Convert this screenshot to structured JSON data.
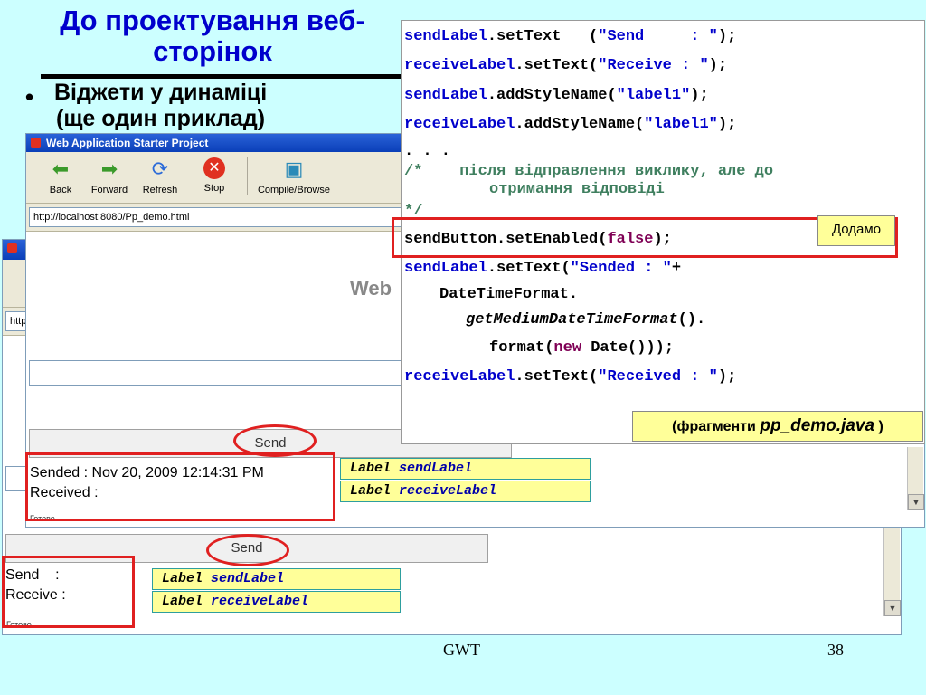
{
  "slide": {
    "title_line1": "До проектування веб-",
    "title_line2": "сторінок",
    "bullet_line1": "Віджети у динаміці",
    "bullet_line2": "(ще один приклад)",
    "footer_center": "GWT",
    "page_number": "38"
  },
  "browser": {
    "window_title": "Web Application Starter Project",
    "toolbar": {
      "back": "Back",
      "forward": "Forward",
      "refresh": "Refresh",
      "stop": "Stop",
      "compile": "Compile/Browse"
    },
    "address": "http://localhost:8080/Pp_demo.html",
    "address_back": "http:",
    "page_heading_partial": "Web",
    "status_text": "Готово"
  },
  "front_window": {
    "send_button": "Send",
    "sent_text": "Sended : Nov 20, 2009 12:14:31 PM",
    "received_text": "Received :"
  },
  "back_window": {
    "send_button": "Send",
    "send_text": "Send    :",
    "receive_text": "Receive :"
  },
  "labels": {
    "type": "Label",
    "send_name": "sendLabel",
    "receive_name": "receiveLabel"
  },
  "code": {
    "l1_var": "sendLabel",
    "l1_a": ".setText   (",
    "l1_str": "\"Send     : \"",
    "l1_b": ");",
    "l2_var": "receiveLabel",
    "l2_a": ".setText(",
    "l2_str": "\"Receive : \"",
    "l2_b": ");",
    "l3_var": "sendLabel",
    "l3_a": ".addStyleName(",
    "l3_str": "\"label1\"",
    "l3_b": ");",
    "l4_var": "receiveLabel",
    "l4_a": ".addStyleName(",
    "l4_str": "\"label1\"",
    "l4_b": ");",
    "l5": ". . .",
    "l6": "/*    після відправлення виклику, але до",
    "l7": "отримання відповіді",
    "l8": "*/",
    "l9_a": "sendButton.setEnabled(",
    "l9_kw": "false",
    "l9_b": ");",
    "l10_var": "sendLabel",
    "l10_a": ".setText(",
    "l10_str": "\"Sended : \"",
    "l10_b": "+",
    "l11": "DateTimeFormat.",
    "l12_a": "getMediumDateTimeFormat",
    "l12_b": "().",
    "l13_a": "format(",
    "l13_kw": "new",
    "l13_b": " Date()));",
    "l14_var": "receiveLabel",
    "l14_a": ".setText(",
    "l14_str": "\"Received : \"",
    "l14_b": ");"
  },
  "callouts": {
    "dodamo": "Додамо",
    "fragments_prefix": "(фрагменти",
    "fragments_file": "pp_demo.java",
    "fragments_suffix": ")"
  },
  "colors": {
    "background": "#ccffff",
    "title": "#0000cc",
    "highlight_red": "#e02020",
    "label_yellow": "#ffff99"
  }
}
